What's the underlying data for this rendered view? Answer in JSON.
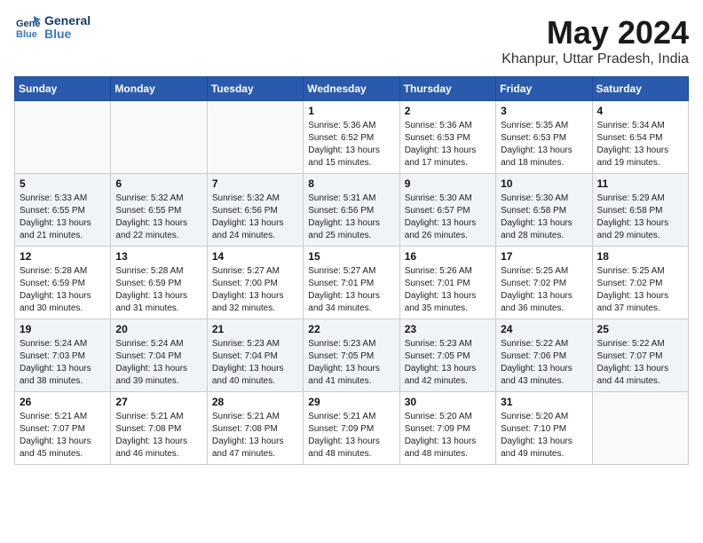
{
  "logo": {
    "line1": "General",
    "line2": "Blue"
  },
  "title": "May 2024",
  "location": "Khanpur, Uttar Pradesh, India",
  "weekdays": [
    "Sunday",
    "Monday",
    "Tuesday",
    "Wednesday",
    "Thursday",
    "Friday",
    "Saturday"
  ],
  "weeks": [
    [
      {
        "day": "",
        "info": ""
      },
      {
        "day": "",
        "info": ""
      },
      {
        "day": "",
        "info": ""
      },
      {
        "day": "1",
        "info": "Sunrise: 5:36 AM\nSunset: 6:52 PM\nDaylight: 13 hours\nand 15 minutes."
      },
      {
        "day": "2",
        "info": "Sunrise: 5:36 AM\nSunset: 6:53 PM\nDaylight: 13 hours\nand 17 minutes."
      },
      {
        "day": "3",
        "info": "Sunrise: 5:35 AM\nSunset: 6:53 PM\nDaylight: 13 hours\nand 18 minutes."
      },
      {
        "day": "4",
        "info": "Sunrise: 5:34 AM\nSunset: 6:54 PM\nDaylight: 13 hours\nand 19 minutes."
      }
    ],
    [
      {
        "day": "5",
        "info": "Sunrise: 5:33 AM\nSunset: 6:55 PM\nDaylight: 13 hours\nand 21 minutes."
      },
      {
        "day": "6",
        "info": "Sunrise: 5:32 AM\nSunset: 6:55 PM\nDaylight: 13 hours\nand 22 minutes."
      },
      {
        "day": "7",
        "info": "Sunrise: 5:32 AM\nSunset: 6:56 PM\nDaylight: 13 hours\nand 24 minutes."
      },
      {
        "day": "8",
        "info": "Sunrise: 5:31 AM\nSunset: 6:56 PM\nDaylight: 13 hours\nand 25 minutes."
      },
      {
        "day": "9",
        "info": "Sunrise: 5:30 AM\nSunset: 6:57 PM\nDaylight: 13 hours\nand 26 minutes."
      },
      {
        "day": "10",
        "info": "Sunrise: 5:30 AM\nSunset: 6:58 PM\nDaylight: 13 hours\nand 28 minutes."
      },
      {
        "day": "11",
        "info": "Sunrise: 5:29 AM\nSunset: 6:58 PM\nDaylight: 13 hours\nand 29 minutes."
      }
    ],
    [
      {
        "day": "12",
        "info": "Sunrise: 5:28 AM\nSunset: 6:59 PM\nDaylight: 13 hours\nand 30 minutes."
      },
      {
        "day": "13",
        "info": "Sunrise: 5:28 AM\nSunset: 6:59 PM\nDaylight: 13 hours\nand 31 minutes."
      },
      {
        "day": "14",
        "info": "Sunrise: 5:27 AM\nSunset: 7:00 PM\nDaylight: 13 hours\nand 32 minutes."
      },
      {
        "day": "15",
        "info": "Sunrise: 5:27 AM\nSunset: 7:01 PM\nDaylight: 13 hours\nand 34 minutes."
      },
      {
        "day": "16",
        "info": "Sunrise: 5:26 AM\nSunset: 7:01 PM\nDaylight: 13 hours\nand 35 minutes."
      },
      {
        "day": "17",
        "info": "Sunrise: 5:25 AM\nSunset: 7:02 PM\nDaylight: 13 hours\nand 36 minutes."
      },
      {
        "day": "18",
        "info": "Sunrise: 5:25 AM\nSunset: 7:02 PM\nDaylight: 13 hours\nand 37 minutes."
      }
    ],
    [
      {
        "day": "19",
        "info": "Sunrise: 5:24 AM\nSunset: 7:03 PM\nDaylight: 13 hours\nand 38 minutes."
      },
      {
        "day": "20",
        "info": "Sunrise: 5:24 AM\nSunset: 7:04 PM\nDaylight: 13 hours\nand 39 minutes."
      },
      {
        "day": "21",
        "info": "Sunrise: 5:23 AM\nSunset: 7:04 PM\nDaylight: 13 hours\nand 40 minutes."
      },
      {
        "day": "22",
        "info": "Sunrise: 5:23 AM\nSunset: 7:05 PM\nDaylight: 13 hours\nand 41 minutes."
      },
      {
        "day": "23",
        "info": "Sunrise: 5:23 AM\nSunset: 7:05 PM\nDaylight: 13 hours\nand 42 minutes."
      },
      {
        "day": "24",
        "info": "Sunrise: 5:22 AM\nSunset: 7:06 PM\nDaylight: 13 hours\nand 43 minutes."
      },
      {
        "day": "25",
        "info": "Sunrise: 5:22 AM\nSunset: 7:07 PM\nDaylight: 13 hours\nand 44 minutes."
      }
    ],
    [
      {
        "day": "26",
        "info": "Sunrise: 5:21 AM\nSunset: 7:07 PM\nDaylight: 13 hours\nand 45 minutes."
      },
      {
        "day": "27",
        "info": "Sunrise: 5:21 AM\nSunset: 7:08 PM\nDaylight: 13 hours\nand 46 minutes."
      },
      {
        "day": "28",
        "info": "Sunrise: 5:21 AM\nSunset: 7:08 PM\nDaylight: 13 hours\nand 47 minutes."
      },
      {
        "day": "29",
        "info": "Sunrise: 5:21 AM\nSunset: 7:09 PM\nDaylight: 13 hours\nand 48 minutes."
      },
      {
        "day": "30",
        "info": "Sunrise: 5:20 AM\nSunset: 7:09 PM\nDaylight: 13 hours\nand 48 minutes."
      },
      {
        "day": "31",
        "info": "Sunrise: 5:20 AM\nSunset: 7:10 PM\nDaylight: 13 hours\nand 49 minutes."
      },
      {
        "day": "",
        "info": ""
      }
    ]
  ]
}
